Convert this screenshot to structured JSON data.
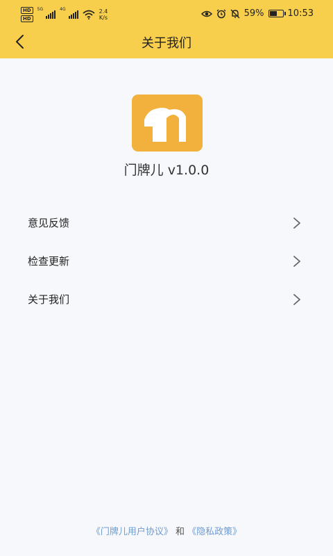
{
  "status_bar": {
    "network_speed": "2.4",
    "network_unit": "K/s",
    "battery_percent": "59%",
    "battery_level": 0.59,
    "time": "10:53"
  },
  "header": {
    "title": "关于我们",
    "back_icon": "chevron-left-icon"
  },
  "app": {
    "name_version": "门牌儿 v1.0.0",
    "logo_icon": "app-logo-icon"
  },
  "menu": {
    "items": [
      {
        "label": "意见反馈"
      },
      {
        "label": "检查更新"
      },
      {
        "label": "关于我们"
      }
    ]
  },
  "footer": {
    "user_agreement": "《门牌儿用户协议》",
    "conjunction": "和",
    "privacy_policy": "《隐私政策》"
  },
  "colors": {
    "header_bg": "#F8CF4C",
    "logo_bg": "#F2B03C",
    "page_bg": "#F7F8FB",
    "link": "#6F9CD0"
  }
}
